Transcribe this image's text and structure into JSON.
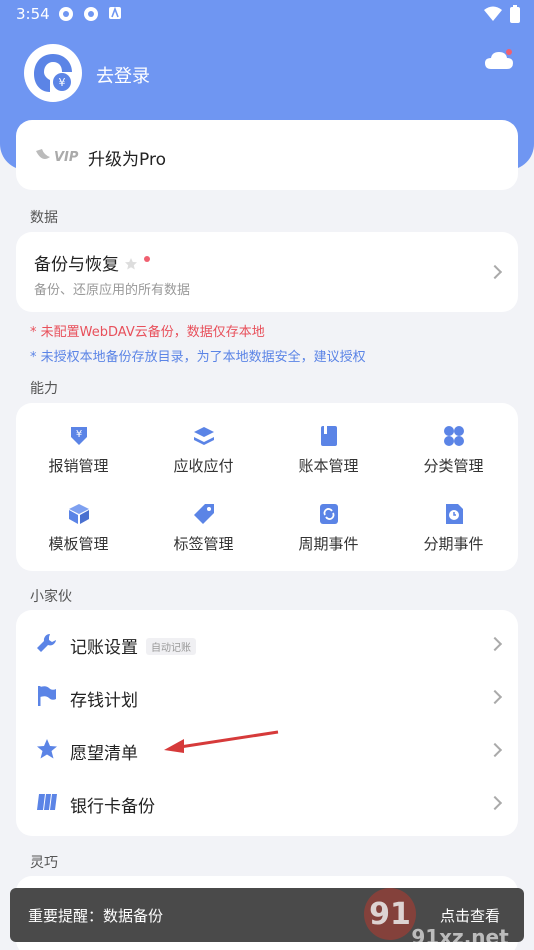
{
  "status_bar": {
    "time": "3:54"
  },
  "header": {
    "login_text": "去登录"
  },
  "pro": {
    "badge": "VIP",
    "label": "升级为Pro"
  },
  "sections": {
    "data": "数据",
    "ability": "能力",
    "tools": "小家伙",
    "flexible": "灵巧"
  },
  "backup": {
    "title": "备份与恢复",
    "subtitle": "备份、还原应用的所有数据",
    "warn1": "* 未配置WebDAV云备份，数据仅存本地",
    "warn2": "* 未授权本地备份存放目录，为了本地数据安全，建议授权"
  },
  "grid": [
    {
      "label": "报销管理",
      "icon": "reimburse-icon"
    },
    {
      "label": "应收应付",
      "icon": "layers-icon"
    },
    {
      "label": "账本管理",
      "icon": "book-icon"
    },
    {
      "label": "分类管理",
      "icon": "category-icon"
    },
    {
      "label": "模板管理",
      "icon": "box-icon"
    },
    {
      "label": "标签管理",
      "icon": "tag-icon"
    },
    {
      "label": "周期事件",
      "icon": "cycle-icon"
    },
    {
      "label": "分期事件",
      "icon": "installment-icon"
    }
  ],
  "tools": [
    {
      "label": "记账设置",
      "tag": "自动记账",
      "icon": "wrench-icon"
    },
    {
      "label": "存钱计划",
      "icon": "flag-icon"
    },
    {
      "label": "愿望清单",
      "icon": "star-icon"
    },
    {
      "label": "银行卡备份",
      "icon": "card-icon"
    }
  ],
  "toast": {
    "message": "重要提醒：数据备份",
    "action": "点击查看"
  },
  "watermark": "91xz.net",
  "colors": {
    "header": "#6f96f2",
    "accent": "#5b84e6",
    "warn_red": "#e8505b",
    "warn_blue": "#5b84e6"
  }
}
